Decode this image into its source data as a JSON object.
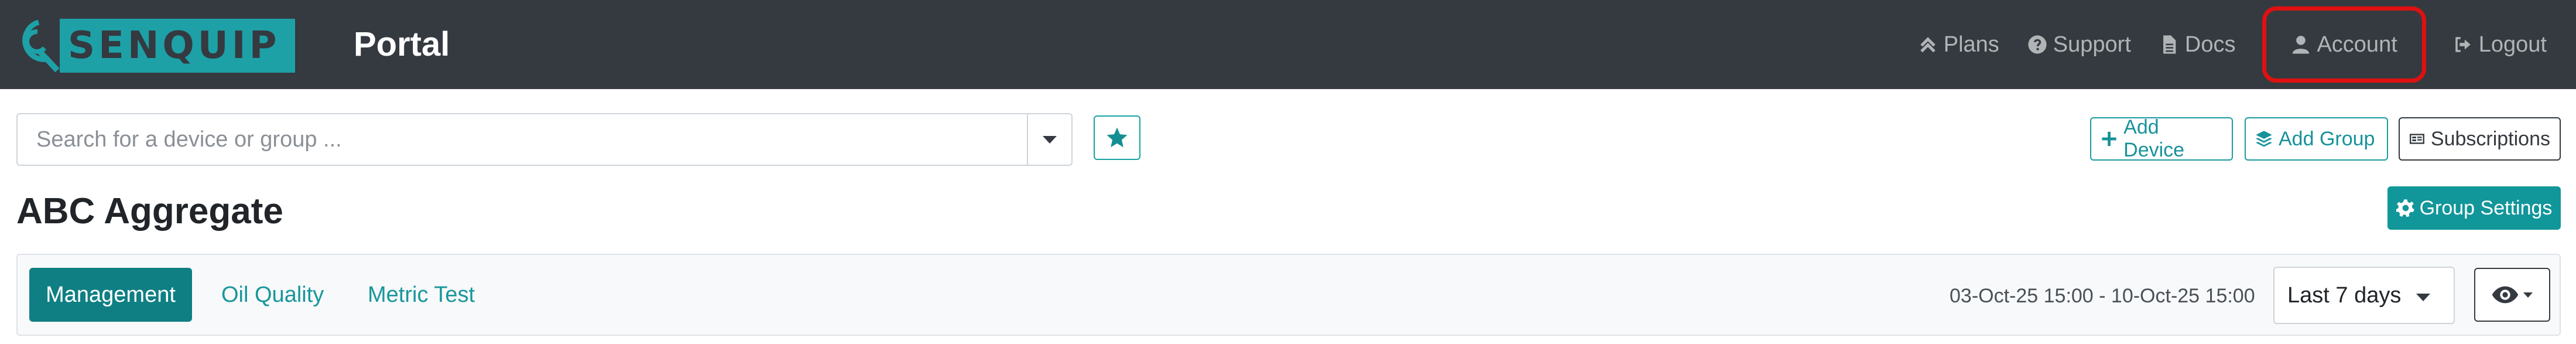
{
  "app": {
    "logo_text": "SENQUIP",
    "portal_title": "Portal"
  },
  "nav": {
    "items": [
      {
        "label": "Plans",
        "icon": "double-chevron-up-icon"
      },
      {
        "label": "Support",
        "icon": "question-circle-icon"
      },
      {
        "label": "Docs",
        "icon": "file-icon"
      },
      {
        "label": "Account",
        "icon": "user-icon",
        "highlighted": true
      },
      {
        "label": "Logout",
        "icon": "sign-out-icon"
      }
    ]
  },
  "search": {
    "placeholder": "Search for a device or group ...",
    "value": ""
  },
  "actions": {
    "add_device": "Add Device",
    "add_group": "Add Group",
    "subscriptions": "Subscriptions"
  },
  "page": {
    "title": "ABC Aggregate",
    "group_settings": "Group Settings"
  },
  "tabs": [
    {
      "label": "Management",
      "active": true
    },
    {
      "label": "Oil Quality",
      "active": false
    },
    {
      "label": "Metric Test",
      "active": false
    }
  ],
  "time": {
    "range": "03-Oct-25 15:00 - 10-Oct-25 15:00",
    "period": "Last 7 days"
  },
  "colors": {
    "navbar": "#343a40",
    "brand_teal": "#1ea0a7",
    "accent": "#11969a",
    "active_tab": "#0f7f83",
    "highlight": "#e01010"
  }
}
